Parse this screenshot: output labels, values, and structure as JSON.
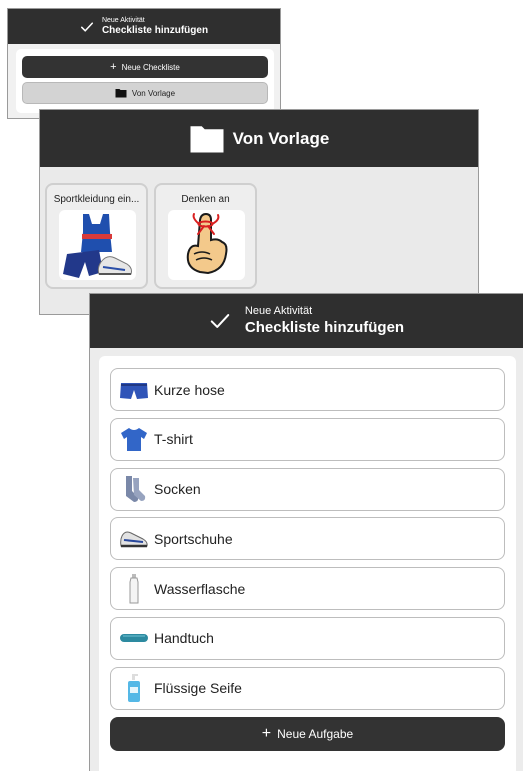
{
  "panel1": {
    "header": {
      "subtitle": "Neue Aktivität",
      "title": "Checkliste hinzufügen"
    },
    "new_checklist_label": "Neue Checkliste",
    "from_template_label": "Von Vorlage"
  },
  "panel2": {
    "header": {
      "title": "Von Vorlage"
    },
    "templates": [
      {
        "label": "Sportkleidung ein...",
        "icon": "sportswear-image"
      },
      {
        "label": "Denken an",
        "icon": "finger-reminder-image"
      }
    ]
  },
  "panel3": {
    "header": {
      "subtitle": "Neue Aktivität",
      "title": "Checkliste hinzufügen"
    },
    "tasks": [
      {
        "label": "Kurze hose",
        "icon": "shorts-icon"
      },
      {
        "label": "T-shirt",
        "icon": "tshirt-icon"
      },
      {
        "label": "Socken",
        "icon": "socks-icon"
      },
      {
        "label": "Sportschuhe",
        "icon": "sneaker-icon"
      },
      {
        "label": "Wasserflasche",
        "icon": "water-bottle-icon"
      },
      {
        "label": "Handtuch",
        "icon": "towel-icon"
      },
      {
        "label": "Flüssige Seife",
        "icon": "soap-icon"
      }
    ],
    "add_task_label": "Neue Aufgabe"
  },
  "colors": {
    "header_bg": "#2f2f2f",
    "button_dark": "#333333",
    "button_light": "#d3d3d3"
  }
}
